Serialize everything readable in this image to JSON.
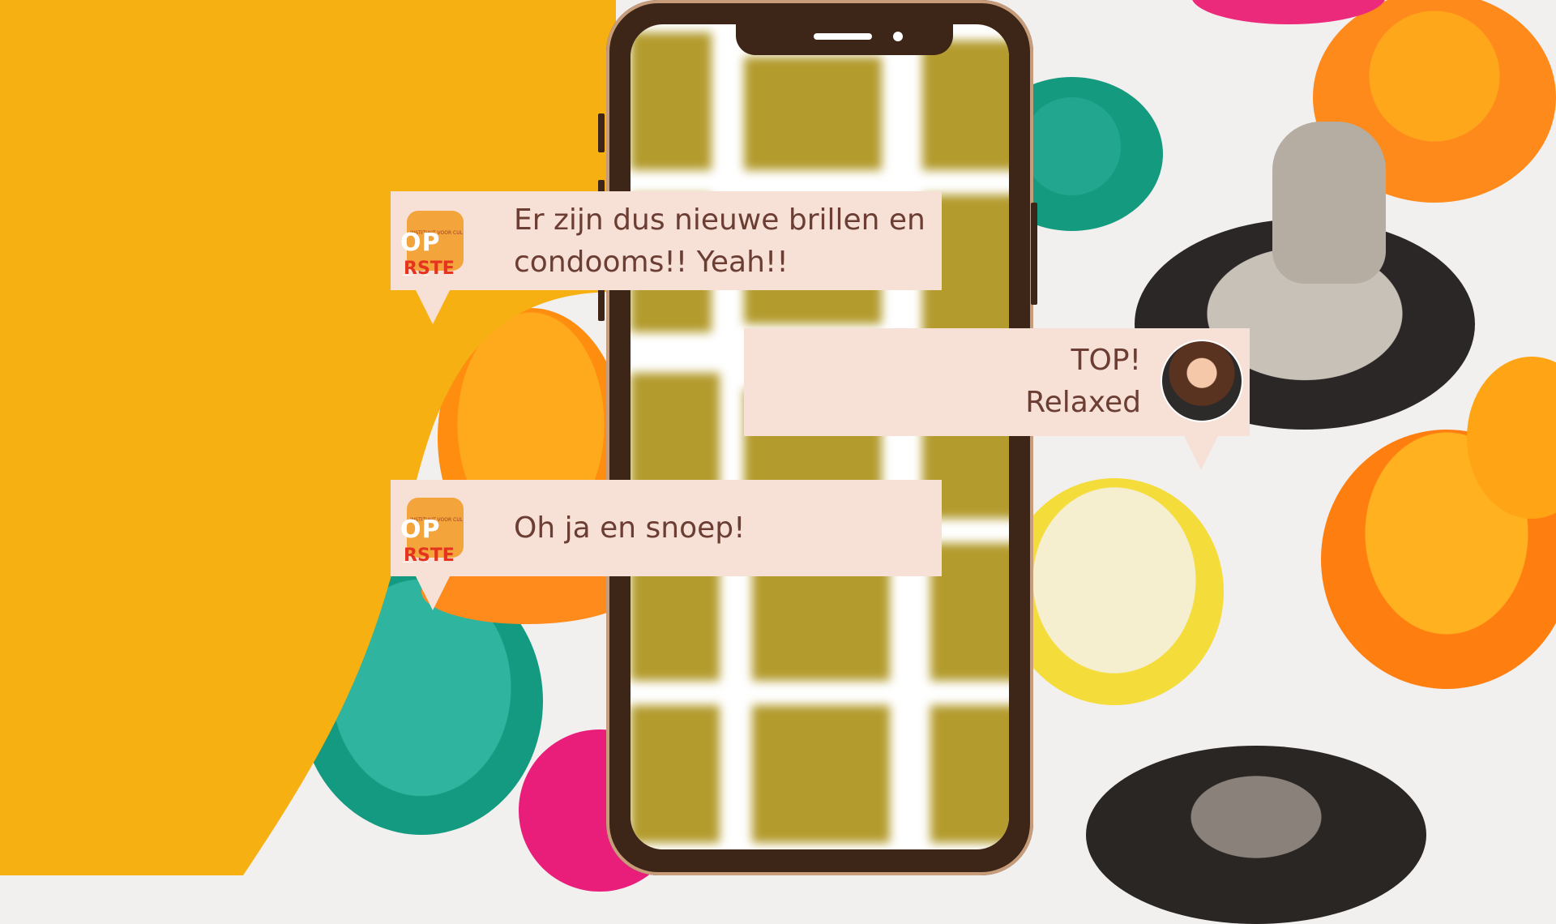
{
  "colors": {
    "yellow": "#f6b012",
    "bubble": "#f7e1d7",
    "text": "#6b3d33",
    "phone": "#3d2517"
  },
  "messages": [
    {
      "sender": "org",
      "text_line1": "Er zijn dus nieuwe brillen en",
      "text_line2": "condooms!! Yeah!!"
    },
    {
      "sender": "user",
      "text_line1": "TOP!",
      "text_line2": "Relaxed"
    },
    {
      "sender": "org",
      "text_line1": "Oh ja en snoep!"
    }
  ],
  "logo": {
    "top": "INSTITUUT VOOR CUL",
    "line1": "OP DI",
    "line2": "RSTE"
  }
}
